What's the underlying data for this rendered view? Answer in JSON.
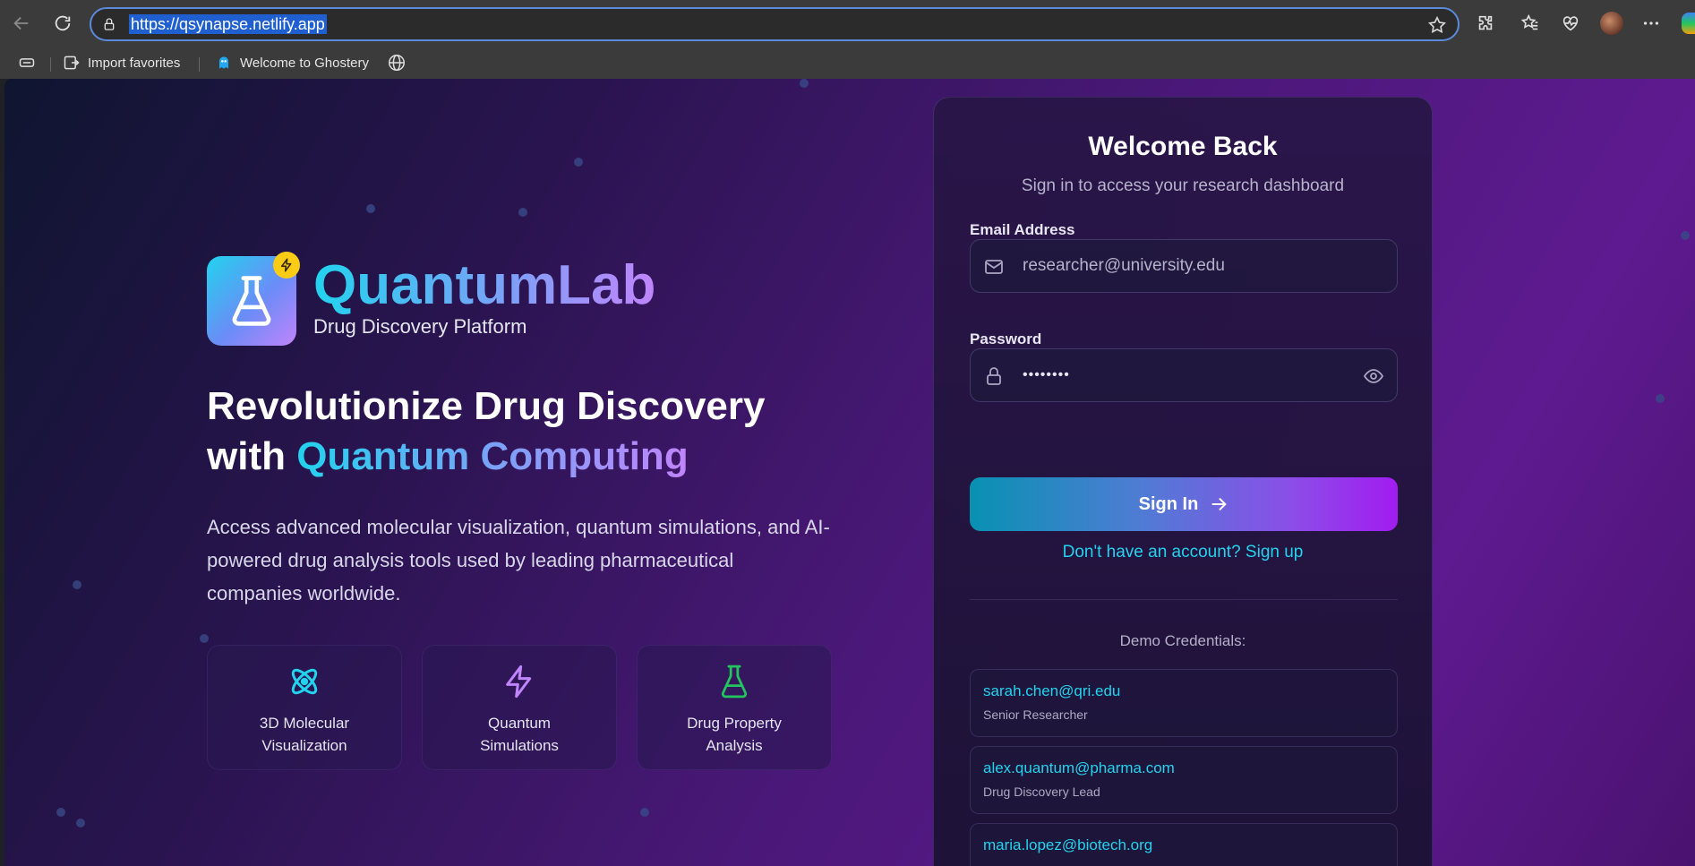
{
  "browser": {
    "url": "https://qsynapse.netlify.app",
    "favorites": [
      {
        "label": "Import favorites"
      },
      {
        "label": "Welcome to Ghostery"
      }
    ]
  },
  "hero": {
    "brand": "QuantumLab",
    "brand_subtitle": "Drug Discovery Platform",
    "headline_line1": "Revolutionize Drug Discovery",
    "headline_with": "with ",
    "headline_accent": "Quantum Computing",
    "description": "Access advanced molecular visualization, quantum simulations, and AI-powered drug analysis tools used by leading pharmaceutical companies worldwide.",
    "features": [
      {
        "icon": "atom-icon",
        "label": "3D Molecular Visualization"
      },
      {
        "icon": "lightning-icon",
        "label": "Quantum Simulations"
      },
      {
        "icon": "flask-icon",
        "label": "Drug Property Analysis"
      }
    ]
  },
  "login": {
    "title": "Welcome Back",
    "subtitle": "Sign in to access your research dashboard",
    "email_label": "Email Address",
    "email_placeholder": "researcher@university.edu",
    "password_label": "Password",
    "password_value": "••••••••",
    "signin_label": "Sign In",
    "signup_text": "Don't have an account? Sign up",
    "demo_title": "Demo Credentials:",
    "demo_credentials": [
      {
        "email": "sarah.chen@qri.edu",
        "role": "Senior Researcher"
      },
      {
        "email": "alex.quantum@pharma.com",
        "role": "Drug Discovery Lead"
      },
      {
        "email": "maria.lopez@biotech.org",
        "role": ""
      }
    ]
  },
  "colors": {
    "accent_cyan": "#22d3ee",
    "accent_purple": "#c084fc",
    "badge_yellow": "#facc15"
  }
}
